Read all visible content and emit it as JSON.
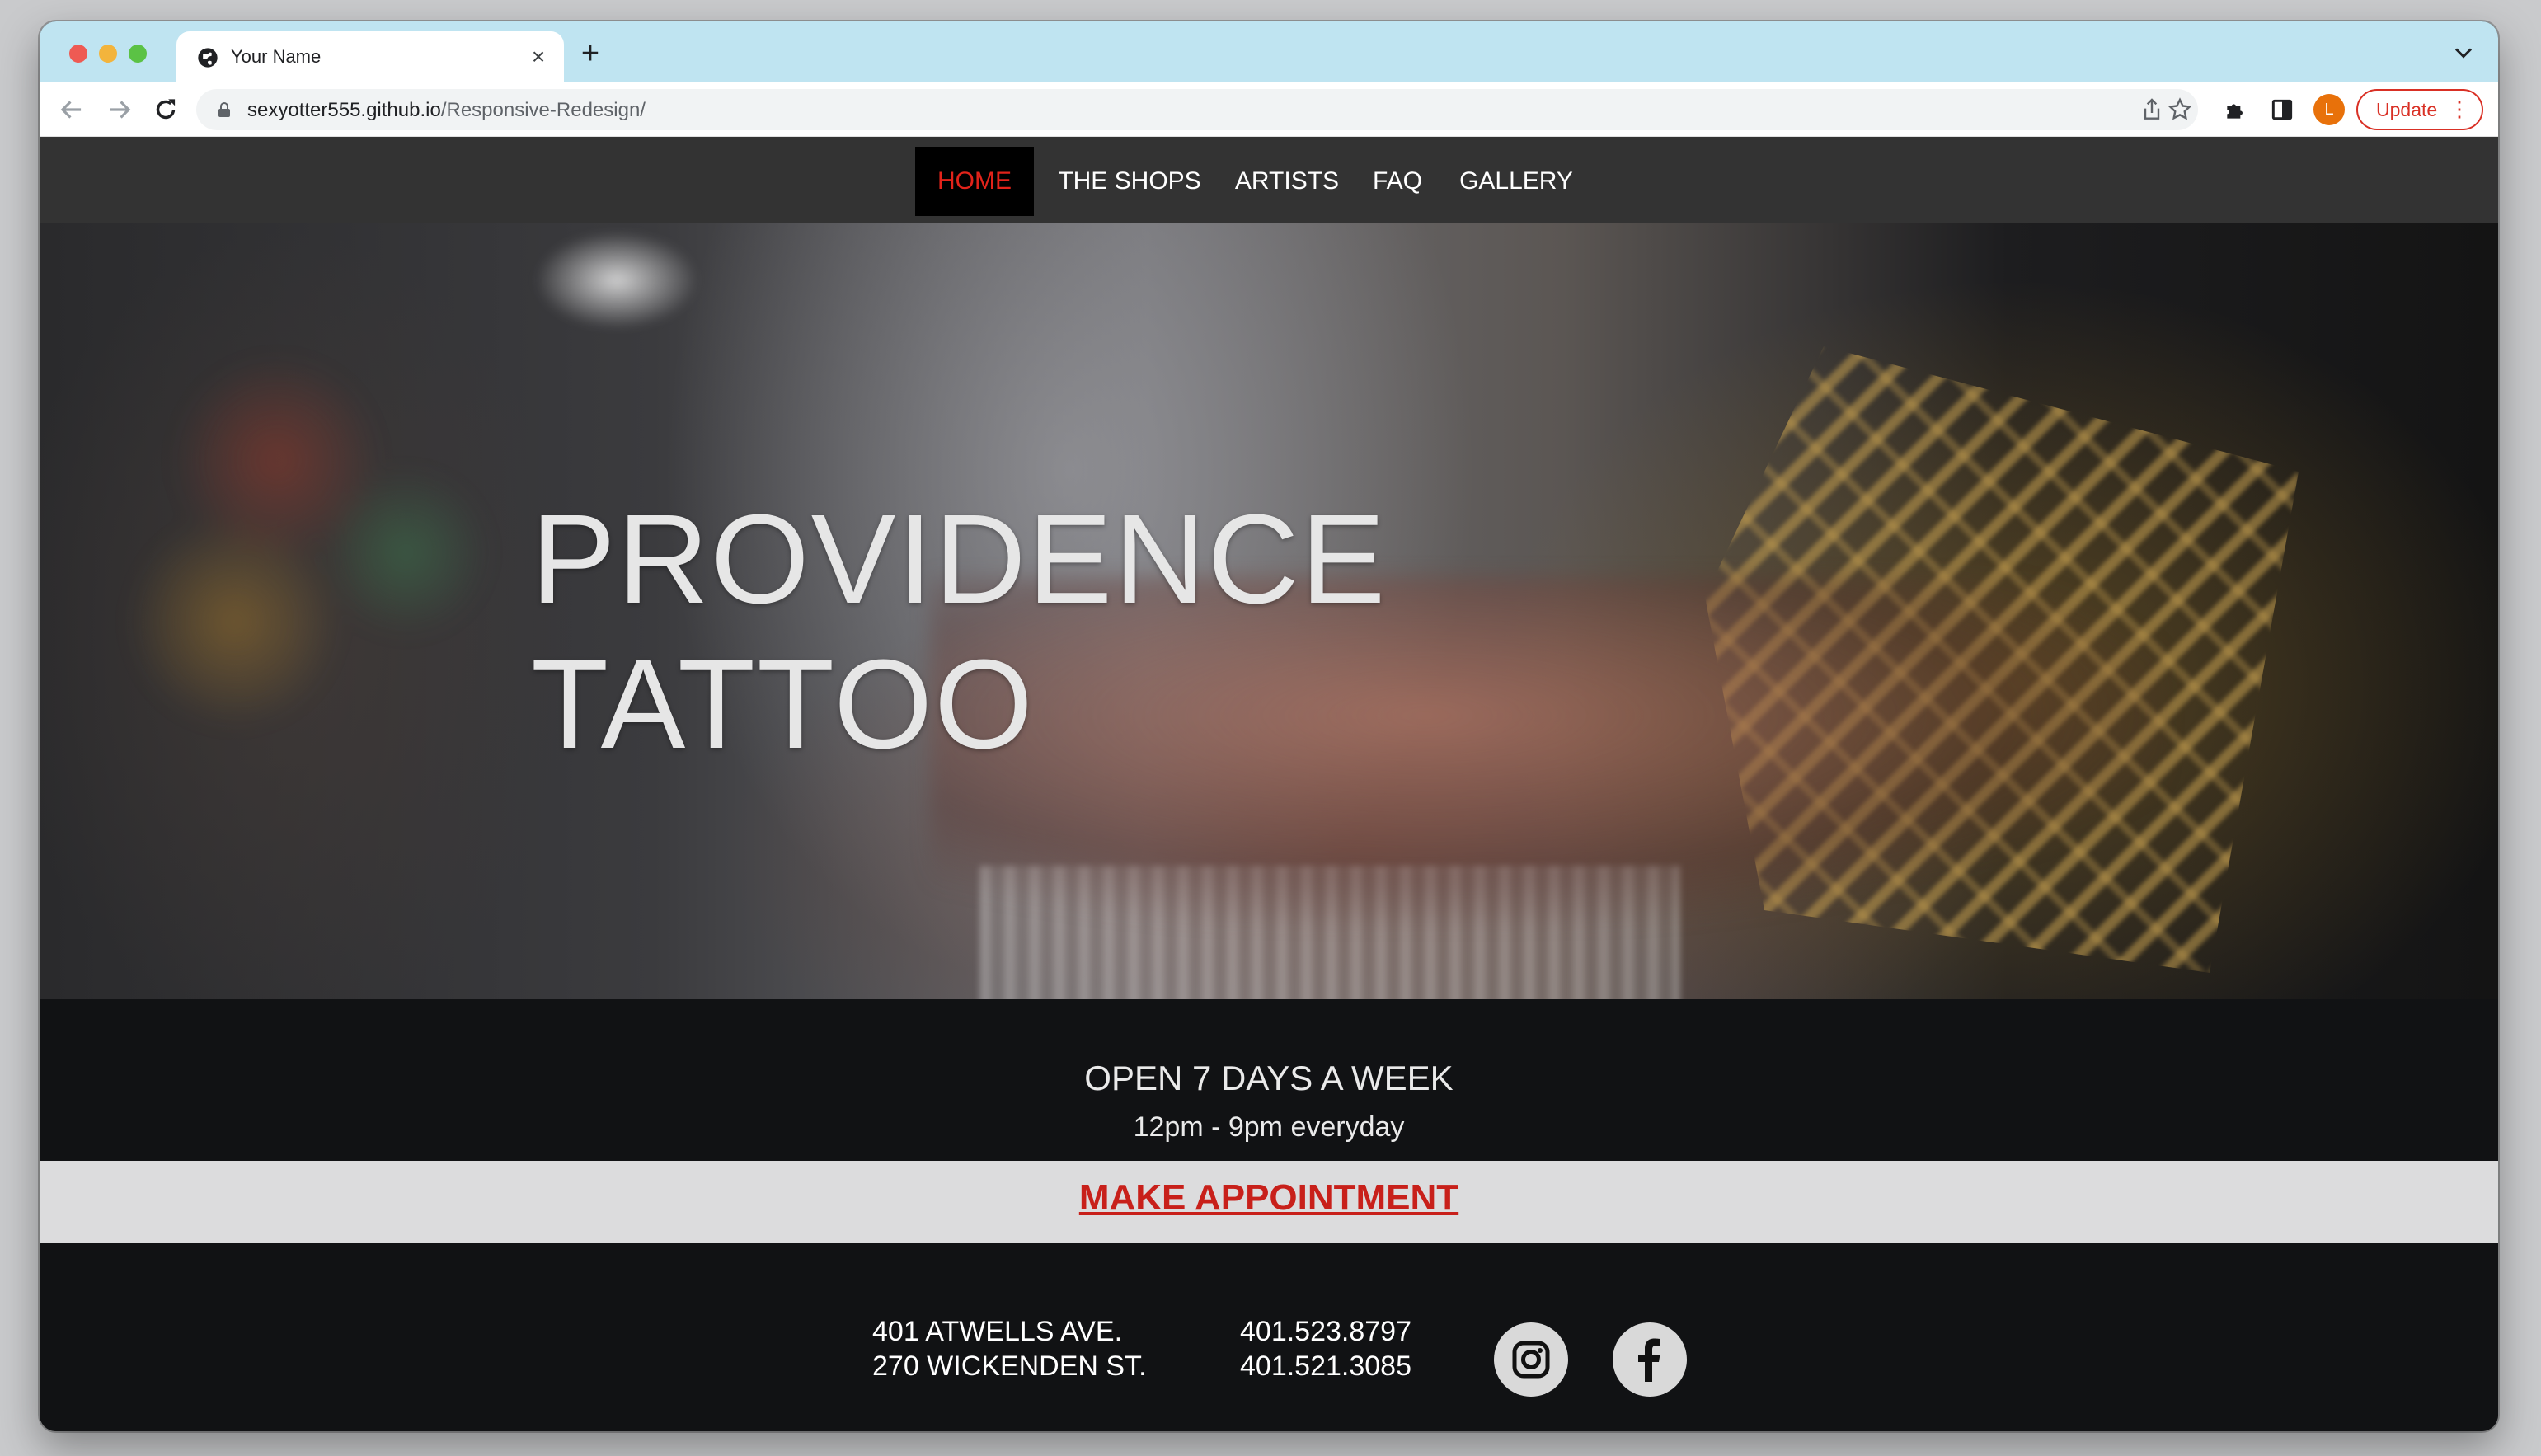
{
  "browser": {
    "tab_title": "Your Name",
    "url_host": "sexyotter555.github.io",
    "url_path": "/Responsive-Redesign/",
    "avatar_letter": "L",
    "update_label": "Update"
  },
  "site": {
    "nav": [
      {
        "label": "HOME",
        "active": true
      },
      {
        "label": "THE SHOPS",
        "active": false
      },
      {
        "label": "ARTISTS",
        "active": false
      },
      {
        "label": "FAQ",
        "active": false
      },
      {
        "label": "GALLERY",
        "active": false
      }
    ],
    "hero": {
      "title_line1": "PROVIDENCE",
      "title_line2": "TATTOO"
    },
    "hours": {
      "title": "OPEN 7 DAYS A WEEK",
      "subtitle": "12pm - 9pm everyday"
    },
    "appointment_label": "MAKE APPOINTMENT",
    "footer": {
      "address_1": "401 ATWELLS AVE.",
      "address_2": "270 WICKENDEN ST.",
      "phone_1": "401.523.8797",
      "phone_2": "401.521.3085"
    }
  },
  "colors": {
    "nav_bg": "#333333",
    "active_nav_text": "#e2231a",
    "appointment_text": "#c8201a",
    "footer_bg": "#111214"
  },
  "icons": [
    "globe-icon",
    "close-icon",
    "plus-icon",
    "back-icon",
    "forward-icon",
    "reload-icon",
    "lock-icon",
    "share-icon",
    "star-icon",
    "puzzle-icon",
    "sidepanel-icon",
    "instagram-icon",
    "facebook-icon"
  ]
}
